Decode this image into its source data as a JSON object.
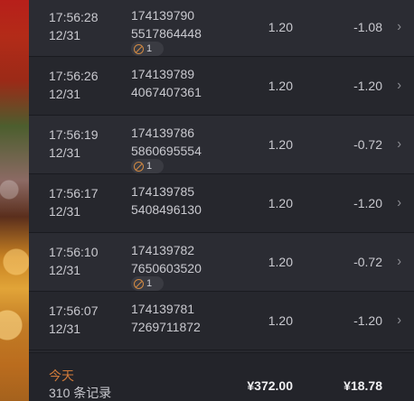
{
  "transactions": [
    {
      "time": "17:56:28",
      "date": "12/31",
      "id_line1": "174139790",
      "id_line2": "5517864448",
      "amount1": "1.20",
      "amount2": "-1.08",
      "badge": "1"
    },
    {
      "time": "17:56:26",
      "date": "12/31",
      "id_line1": "174139789",
      "id_line2": "4067407361",
      "amount1": "1.20",
      "amount2": "-1.20"
    },
    {
      "time": "17:56:19",
      "date": "12/31",
      "id_line1": "174139786",
      "id_line2": "5860695554",
      "amount1": "1.20",
      "amount2": "-0.72",
      "badge": "1"
    },
    {
      "time": "17:56:17",
      "date": "12/31",
      "id_line1": "174139785",
      "id_line2": "5408496130",
      "amount1": "1.20",
      "amount2": "-1.20"
    },
    {
      "time": "17:56:10",
      "date": "12/31",
      "id_line1": "174139782",
      "id_line2": "7650603520",
      "amount1": "1.20",
      "amount2": "-0.72",
      "badge": "1"
    },
    {
      "time": "17:56:07",
      "date": "12/31",
      "id_line1": "174139781",
      "id_line2": "7269711872",
      "amount1": "1.20",
      "amount2": "-1.20"
    }
  ],
  "footer": {
    "label": "今天",
    "count": "310 条记录",
    "total1": "¥372.00",
    "total2": "¥18.78"
  },
  "icons": {
    "row_chevron": "chevron-right-icon",
    "badge": "compass-icon"
  },
  "colors": {
    "accent": "#cf7a3a"
  }
}
